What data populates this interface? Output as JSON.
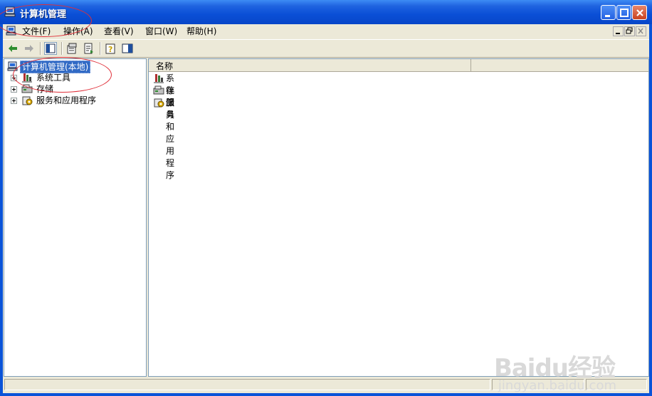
{
  "window": {
    "title": "计算机管理"
  },
  "menu": {
    "items": [
      "文件(F)",
      "操作(A)",
      "查看(V)",
      "窗口(W)",
      "帮助(H)"
    ]
  },
  "toolbar": {
    "icons": [
      "back-arrow-icon",
      "forward-arrow-icon",
      "show-hide-tree-icon",
      "properties-icon",
      "export-list-icon",
      "help-icon",
      "show-hide-action-pane-icon"
    ]
  },
  "tree": {
    "root": "计算机管理(本地)",
    "children": [
      "系统工具",
      "存储",
      "服务和应用程序"
    ]
  },
  "list": {
    "column_name": "名称",
    "items": [
      "系统工具",
      "存储",
      "服务和应用程序"
    ]
  },
  "watermark": {
    "brand": "Baidu经验",
    "url": "jingyan.baidu.com"
  },
  "colors": {
    "titlebar": "#0a4fd6",
    "selection": "#316ac5",
    "annotation": "#e0303a"
  }
}
